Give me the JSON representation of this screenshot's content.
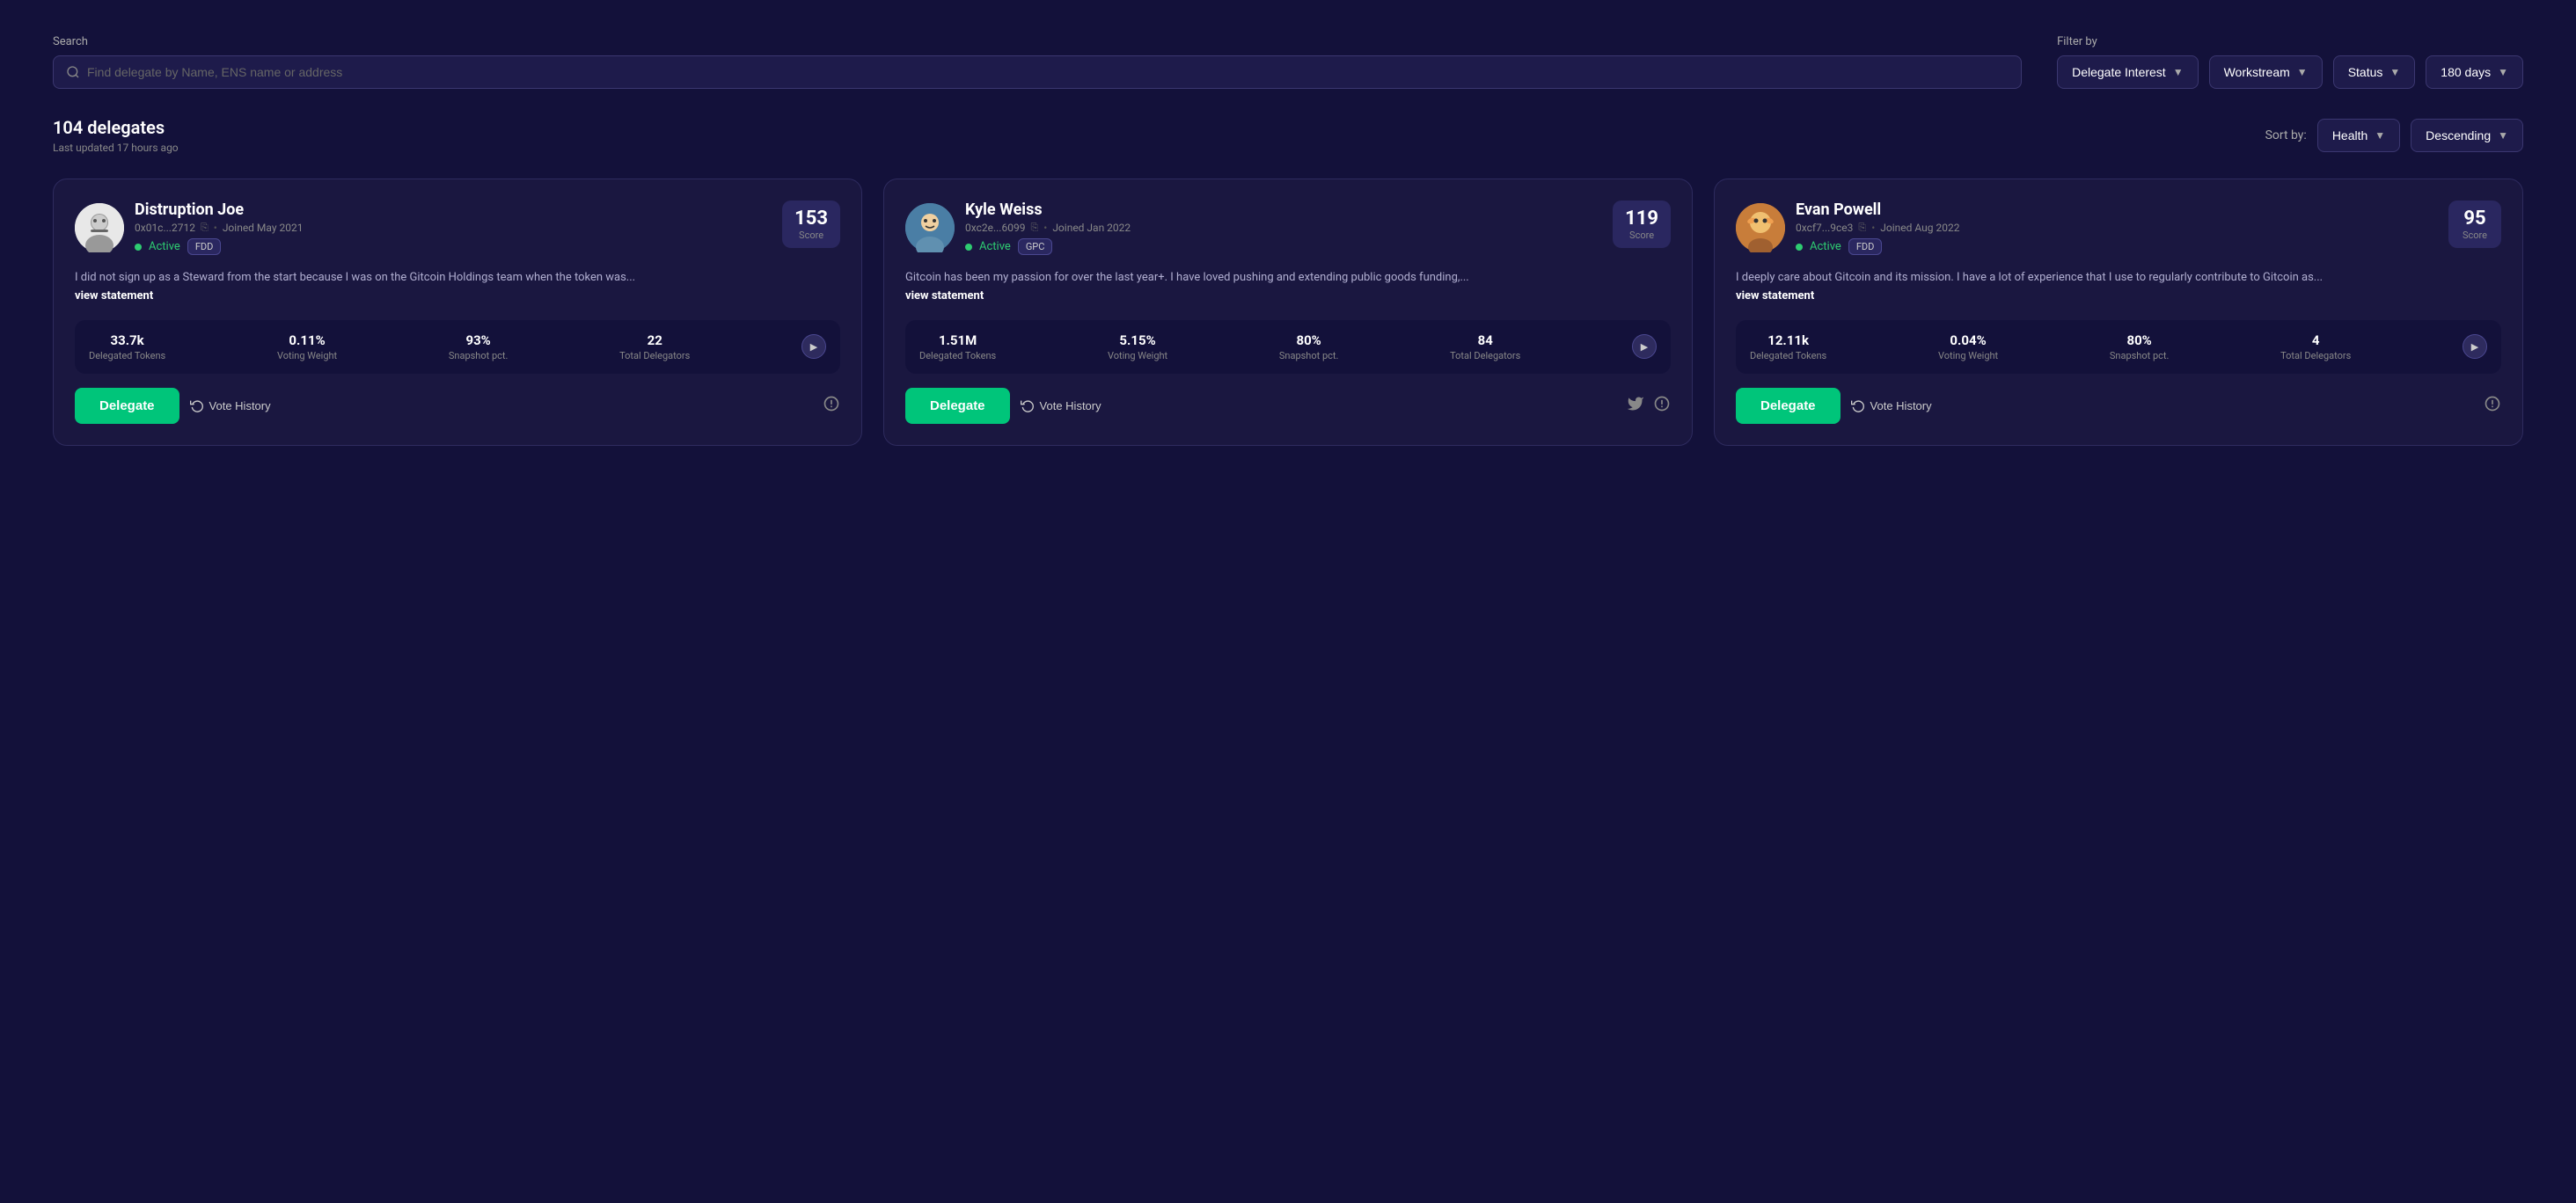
{
  "search": {
    "label": "Search",
    "placeholder": "Find delegate by Name, ENS name or address"
  },
  "filters": {
    "label": "Filter by",
    "options": [
      {
        "id": "delegate-interest",
        "label": "Delegate Interest"
      },
      {
        "id": "workstream",
        "label": "Workstream"
      },
      {
        "id": "status",
        "label": "Status"
      },
      {
        "id": "days",
        "label": "180 days"
      }
    ]
  },
  "delegates_summary": {
    "count": "104 delegates",
    "updated": "Last updated 17 hours ago"
  },
  "sort": {
    "label": "Sort by:",
    "field": "Health",
    "direction": "Descending"
  },
  "delegates": [
    {
      "id": "distruption-joe",
      "name": "Distruption Joe",
      "address": "0x01c...2712",
      "joined": "Joined May 2021",
      "status": "Active",
      "tag": "FDD",
      "score": "153",
      "score_label": "Score",
      "statement": "I did not sign up as a Steward from the start because I was on the Gitcoin Holdings team when the token was...",
      "view_statement": "view statement",
      "stats": {
        "delegated_tokens": "33.7k",
        "voting_weight": "0.11%",
        "snapshot_pct": "93%",
        "total_delegators": "22"
      },
      "delegate_label": "Delegate",
      "vote_history_label": "Vote History",
      "icons": [
        "discourse"
      ]
    },
    {
      "id": "kyle-weiss",
      "name": "Kyle Weiss",
      "address": "0xc2e...6099",
      "joined": "Joined Jan 2022",
      "status": "Active",
      "tag": "GPC",
      "score": "119",
      "score_label": "Score",
      "statement": "Gitcoin has been my passion for over the last year+. I have loved pushing and extending public goods funding,...",
      "view_statement": "view statement",
      "stats": {
        "delegated_tokens": "1.51M",
        "voting_weight": "5.15%",
        "snapshot_pct": "80%",
        "total_delegators": "84"
      },
      "delegate_label": "Delegate",
      "vote_history_label": "Vote History",
      "icons": [
        "twitter",
        "discourse"
      ]
    },
    {
      "id": "evan-powell",
      "name": "Evan Powell",
      "address": "0xcf7...9ce3",
      "joined": "Joined Aug 2022",
      "status": "Active",
      "tag": "FDD",
      "score": "95",
      "score_label": "Score",
      "statement": "I deeply care about Gitcoin and its mission. I have a lot of experience that I use to regularly contribute to Gitcoin as...",
      "view_statement": "view statement",
      "stats": {
        "delegated_tokens": "12.11k",
        "voting_weight": "0.04%",
        "snapshot_pct": "80%",
        "total_delegators": "4"
      },
      "delegate_label": "Delegate",
      "vote_history_label": "Vote History",
      "icons": [
        "discourse"
      ]
    }
  ],
  "stat_labels": {
    "delegated_tokens": "Delegated Tokens",
    "voting_weight": "Voting Weight",
    "snapshot_pct": "Snapshot pct.",
    "total_delegators": "Total Delegators"
  },
  "avatars": {
    "joe": "🧔",
    "kyle": "😊",
    "evan": "🦁"
  }
}
